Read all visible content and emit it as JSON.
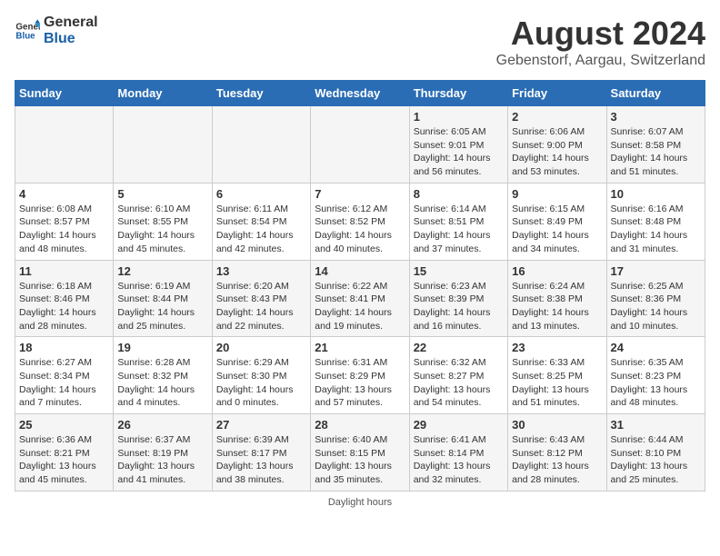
{
  "header": {
    "logo_general": "General",
    "logo_blue": "Blue",
    "title": "August 2024",
    "subtitle": "Gebenstorf, Aargau, Switzerland"
  },
  "days_of_week": [
    "Sunday",
    "Monday",
    "Tuesday",
    "Wednesday",
    "Thursday",
    "Friday",
    "Saturday"
  ],
  "weeks": [
    {
      "days": [
        {
          "num": "",
          "info": ""
        },
        {
          "num": "",
          "info": ""
        },
        {
          "num": "",
          "info": ""
        },
        {
          "num": "",
          "info": ""
        },
        {
          "num": "1",
          "info": "Sunrise: 6:05 AM\nSunset: 9:01 PM\nDaylight: 14 hours and 56 minutes."
        },
        {
          "num": "2",
          "info": "Sunrise: 6:06 AM\nSunset: 9:00 PM\nDaylight: 14 hours and 53 minutes."
        },
        {
          "num": "3",
          "info": "Sunrise: 6:07 AM\nSunset: 8:58 PM\nDaylight: 14 hours and 51 minutes."
        }
      ]
    },
    {
      "days": [
        {
          "num": "4",
          "info": "Sunrise: 6:08 AM\nSunset: 8:57 PM\nDaylight: 14 hours and 48 minutes."
        },
        {
          "num": "5",
          "info": "Sunrise: 6:10 AM\nSunset: 8:55 PM\nDaylight: 14 hours and 45 minutes."
        },
        {
          "num": "6",
          "info": "Sunrise: 6:11 AM\nSunset: 8:54 PM\nDaylight: 14 hours and 42 minutes."
        },
        {
          "num": "7",
          "info": "Sunrise: 6:12 AM\nSunset: 8:52 PM\nDaylight: 14 hours and 40 minutes."
        },
        {
          "num": "8",
          "info": "Sunrise: 6:14 AM\nSunset: 8:51 PM\nDaylight: 14 hours and 37 minutes."
        },
        {
          "num": "9",
          "info": "Sunrise: 6:15 AM\nSunset: 8:49 PM\nDaylight: 14 hours and 34 minutes."
        },
        {
          "num": "10",
          "info": "Sunrise: 6:16 AM\nSunset: 8:48 PM\nDaylight: 14 hours and 31 minutes."
        }
      ]
    },
    {
      "days": [
        {
          "num": "11",
          "info": "Sunrise: 6:18 AM\nSunset: 8:46 PM\nDaylight: 14 hours and 28 minutes."
        },
        {
          "num": "12",
          "info": "Sunrise: 6:19 AM\nSunset: 8:44 PM\nDaylight: 14 hours and 25 minutes."
        },
        {
          "num": "13",
          "info": "Sunrise: 6:20 AM\nSunset: 8:43 PM\nDaylight: 14 hours and 22 minutes."
        },
        {
          "num": "14",
          "info": "Sunrise: 6:22 AM\nSunset: 8:41 PM\nDaylight: 14 hours and 19 minutes."
        },
        {
          "num": "15",
          "info": "Sunrise: 6:23 AM\nSunset: 8:39 PM\nDaylight: 14 hours and 16 minutes."
        },
        {
          "num": "16",
          "info": "Sunrise: 6:24 AM\nSunset: 8:38 PM\nDaylight: 14 hours and 13 minutes."
        },
        {
          "num": "17",
          "info": "Sunrise: 6:25 AM\nSunset: 8:36 PM\nDaylight: 14 hours and 10 minutes."
        }
      ]
    },
    {
      "days": [
        {
          "num": "18",
          "info": "Sunrise: 6:27 AM\nSunset: 8:34 PM\nDaylight: 14 hours and 7 minutes."
        },
        {
          "num": "19",
          "info": "Sunrise: 6:28 AM\nSunset: 8:32 PM\nDaylight: 14 hours and 4 minutes."
        },
        {
          "num": "20",
          "info": "Sunrise: 6:29 AM\nSunset: 8:30 PM\nDaylight: 14 hours and 0 minutes."
        },
        {
          "num": "21",
          "info": "Sunrise: 6:31 AM\nSunset: 8:29 PM\nDaylight: 13 hours and 57 minutes."
        },
        {
          "num": "22",
          "info": "Sunrise: 6:32 AM\nSunset: 8:27 PM\nDaylight: 13 hours and 54 minutes."
        },
        {
          "num": "23",
          "info": "Sunrise: 6:33 AM\nSunset: 8:25 PM\nDaylight: 13 hours and 51 minutes."
        },
        {
          "num": "24",
          "info": "Sunrise: 6:35 AM\nSunset: 8:23 PM\nDaylight: 13 hours and 48 minutes."
        }
      ]
    },
    {
      "days": [
        {
          "num": "25",
          "info": "Sunrise: 6:36 AM\nSunset: 8:21 PM\nDaylight: 13 hours and 45 minutes."
        },
        {
          "num": "26",
          "info": "Sunrise: 6:37 AM\nSunset: 8:19 PM\nDaylight: 13 hours and 41 minutes."
        },
        {
          "num": "27",
          "info": "Sunrise: 6:39 AM\nSunset: 8:17 PM\nDaylight: 13 hours and 38 minutes."
        },
        {
          "num": "28",
          "info": "Sunrise: 6:40 AM\nSunset: 8:15 PM\nDaylight: 13 hours and 35 minutes."
        },
        {
          "num": "29",
          "info": "Sunrise: 6:41 AM\nSunset: 8:14 PM\nDaylight: 13 hours and 32 minutes."
        },
        {
          "num": "30",
          "info": "Sunrise: 6:43 AM\nSunset: 8:12 PM\nDaylight: 13 hours and 28 minutes."
        },
        {
          "num": "31",
          "info": "Sunrise: 6:44 AM\nSunset: 8:10 PM\nDaylight: 13 hours and 25 minutes."
        }
      ]
    }
  ],
  "footer": {
    "note": "Daylight hours"
  }
}
